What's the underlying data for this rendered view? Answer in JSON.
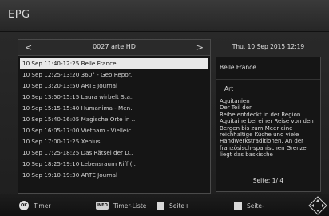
{
  "header": {
    "title": "EPG"
  },
  "channel": {
    "name": "0027 arte HD",
    "prev": "<",
    "next": ">"
  },
  "programs": [
    {
      "text": "10 Sep 11:40-12:25  Belle France",
      "selected": true
    },
    {
      "text": "10 Sep 12:25-13:20  360° - Geo Repor.."
    },
    {
      "text": "10 Sep 13:20-13:50  ARTE Journal"
    },
    {
      "text": "10 Sep 13:50-15:15  Laura wirbelt Sta.."
    },
    {
      "text": "10 Sep 15:15-15:40  Humanima - Men.."
    },
    {
      "text": "10 Sep 15:40-16:05  Magische Orte in .."
    },
    {
      "text": "10 Sep 16:05-17:00  Vietnam - Vielleic.."
    },
    {
      "text": "10 Sep 17:00-17:25  Xenius"
    },
    {
      "text": "10 Sep 17:25-18:25  Das Rätsel der D.."
    },
    {
      "text": "10 Sep 18:25-19:10  Lebensraum Riff (.."
    },
    {
      "text": "10 Sep 19:10-19:30  ARTE Journal"
    }
  ],
  "info": {
    "datetime": "Thu.  10 Sep 2015 12:19",
    "title": "Belle France",
    "category": "Art",
    "description": "Aquitanien\nDer Teil der\nReihe entdeckt in der Region Aquitaine bei einer Reise von den Bergen bis zum Meer eine reichhaltige Küche und viele Handwerkstraditionen. An der\nfranzösisch-spanischen Grenze liegt das baskische",
    "page": "Seite:  1/ 4"
  },
  "footer": {
    "ok_icon": "OK",
    "timer": "Timer",
    "info_icon": "INFO",
    "timer_list": "Timer-Liste",
    "page_up": "Seite+",
    "page_down": "Seite-",
    "nav_icon": "directional-pad"
  }
}
